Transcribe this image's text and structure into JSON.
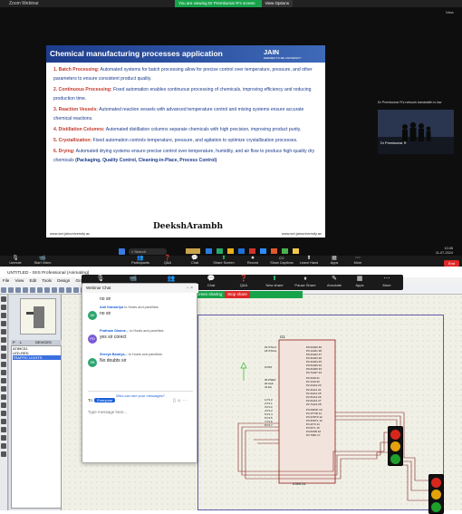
{
  "top_window": {
    "title": "Zoom Webinar",
    "banner_text": "You are viewing Dr Premkumar R's screen",
    "view_options": "View Options",
    "view_label": "View",
    "slide": {
      "title": "Chemical manufacturing processes application",
      "logo": "JAIN",
      "logo_sub": "DEEMED-TO-BE UNIVERSITY",
      "items": [
        {
          "num": "1.",
          "term": "Batch Processing:",
          "text": "Automated systems for batch processing allow for precise control over temperature, pressure, and other parameters to ensure consistent product quality."
        },
        {
          "num": "2.",
          "term": "Continuous Processing:",
          "text": "Fixed automation enables continuous processing of chemicals, improving efficiency and reducing production time."
        },
        {
          "num": "3.",
          "term": "Reaction Vessels:",
          "text": "Automated reaction vessels with advanced temperature control and mixing systems ensure accurate chemical reactions."
        },
        {
          "num": "4.",
          "term": "Distillation Columns:",
          "text": "Automated distillation columns separate chemicals with high precision, improving product purity."
        },
        {
          "num": "5.",
          "term": "Crystallization:",
          "text": "Fixed automation controls temperature, pressure, and agitation to optimize crystallization processes."
        },
        {
          "num": "6.",
          "term": "Drying:",
          "text": "Automated drying systems ensure precise control over temperature, humidity, and air flow to produce high-quality dry chemicals"
        }
      ],
      "drying_tail": "(Packaging, Quality Control, Cleaning-in-Place, Process Control)",
      "footer_left": "www.set.jainuniversity.ac",
      "footer_center": "DeekshArambh",
      "footer_right": "www.set.jainuniversity.ac"
    },
    "camera": {
      "caption": "Dr Premkumar R's network bandwidth is low",
      "name": "Dr Premkumar R"
    },
    "toolbar": [
      {
        "icon": "🎙",
        "label": "Unmute"
      },
      {
        "icon": "📹",
        "label": "Start Video"
      },
      {
        "icon": "👥",
        "label": "Participants",
        "badge": "97"
      },
      {
        "icon": "❓",
        "label": "Q&A"
      },
      {
        "icon": "💬",
        "label": "Chat",
        "badge": "12"
      },
      {
        "icon": "⬆",
        "label": "Share Screen"
      },
      {
        "icon": "⏺",
        "label": "Record"
      },
      {
        "icon": "CC",
        "label": "Show Captions"
      },
      {
        "icon": "⬆",
        "label": "Leave Hand"
      },
      {
        "icon": "▦",
        "label": "Apps"
      },
      {
        "icon": "⋯",
        "label": "More"
      }
    ],
    "end_label": "End",
    "taskbar": {
      "search": "Search",
      "time": "10:45",
      "date": "11-07-2024"
    }
  },
  "bottom_window": {
    "title": "UNTITLED - ISIS Professional (Animating)",
    "menu": [
      "File",
      "View",
      "Edit",
      "Tools",
      "Design",
      "Graph"
    ],
    "zoom_bar": [
      {
        "icon": "🎙",
        "label": "Mute"
      },
      {
        "icon": "📹",
        "label": "Start Video"
      },
      {
        "icon": "👥",
        "label": "Participants",
        "badge": "97"
      },
      {
        "icon": "💬",
        "label": "Chat",
        "badge": "12"
      },
      {
        "icon": "❓",
        "label": "Q&A"
      },
      {
        "icon": "⬆",
        "label": "New share"
      },
      {
        "icon": "⏸",
        "label": "Pause Share"
      },
      {
        "icon": "✎",
        "label": "Annotate"
      },
      {
        "icon": "▦",
        "label": "Apps"
      },
      {
        "icon": "⋯",
        "label": "More"
      }
    ],
    "sharing_text": "You are screen sharing",
    "stop_share": "Stop share",
    "device_tabs": [
      "P",
      "L",
      "DEVICES"
    ],
    "devices": [
      "AT89C51",
      "LED-RED",
      "TRAFFIC LIGHTS"
    ],
    "selected_device": 2,
    "chip": {
      "ref": "U1",
      "part": "AT89C51",
      "left_pins": [
        {
          "num": "19",
          "name": "XTAL1"
        },
        {
          "num": "18",
          "name": "XTAL2"
        },
        {
          "num": "9",
          "name": "RST"
        },
        {
          "num": "29",
          "name": "PSEN"
        },
        {
          "num": "30",
          "name": "ALE"
        },
        {
          "num": "31",
          "name": "EA"
        },
        {
          "num": "1",
          "name": "P1.0"
        },
        {
          "num": "2",
          "name": "P1.1"
        },
        {
          "num": "3",
          "name": "P1.2"
        },
        {
          "num": "4",
          "name": "P1.3"
        },
        {
          "num": "5",
          "name": "P1.4"
        },
        {
          "num": "6",
          "name": "P1.5"
        },
        {
          "num": "7",
          "name": "P1.6"
        },
        {
          "num": "8",
          "name": "P1.7"
        }
      ],
      "right_pins": [
        {
          "num": "39",
          "name": "P0.0/AD0"
        },
        {
          "num": "38",
          "name": "P0.1/AD1"
        },
        {
          "num": "37",
          "name": "P0.2/AD2"
        },
        {
          "num": "36",
          "name": "P0.3/AD3"
        },
        {
          "num": "35",
          "name": "P0.4/AD4"
        },
        {
          "num": "34",
          "name": "P0.5/AD5"
        },
        {
          "num": "33",
          "name": "P0.6/AD6"
        },
        {
          "num": "32",
          "name": "P0.7/AD7"
        },
        {
          "num": "21",
          "name": "P2.0/A8"
        },
        {
          "num": "22",
          "name": "P2.1/A9"
        },
        {
          "num": "23",
          "name": "P2.2/A10"
        },
        {
          "num": "24",
          "name": "P2.3/A11"
        },
        {
          "num": "25",
          "name": "P2.4/A12"
        },
        {
          "num": "26",
          "name": "P2.5/A13"
        },
        {
          "num": "27",
          "name": "P2.6/A14"
        },
        {
          "num": "28",
          "name": "P2.7/A15"
        },
        {
          "num": "10",
          "name": "P3.0/RXD"
        },
        {
          "num": "11",
          "name": "P3.1/TXD"
        },
        {
          "num": "12",
          "name": "P3.2/INT0"
        },
        {
          "num": "13",
          "name": "P3.3/INT1"
        },
        {
          "num": "14",
          "name": "P3.4/T0"
        },
        {
          "num": "15",
          "name": "P3.5/T1"
        },
        {
          "num": "16",
          "name": "P3.6/WR"
        },
        {
          "num": "17",
          "name": "P3.7/RD"
        }
      ]
    },
    "chat": {
      "title": "Webinar Chat",
      "messages": [
        {
          "from": "",
          "to": "",
          "initials": "",
          "text": "no sir",
          "color": "#7a5ad8"
        },
        {
          "from": "Anil Kanzariya",
          "to": "to Hosts and panelists",
          "initials": "AK",
          "text": "no sir",
          "color": "#2ba66f"
        },
        {
          "from": "Pratham Dhame...",
          "to": "to Hosts and panelists",
          "initials": "PD",
          "text": "yes sir corect",
          "color": "#7a5ad8"
        },
        {
          "from": "Shreya Baraiya...",
          "to": "to Hosts and panelists",
          "initials": "SB",
          "text": "No doubts sir",
          "color": "#2ba66f"
        }
      ],
      "who_can_see": "Who can see your messages?",
      "to_label": "To:",
      "to_value": "Everyone",
      "placeholder": "Type message here..."
    },
    "colors": {
      "red": "#d9261c",
      "amber": "#e3a20c",
      "green": "#1f9e2b",
      "wire": "#7e1c1c"
    }
  }
}
